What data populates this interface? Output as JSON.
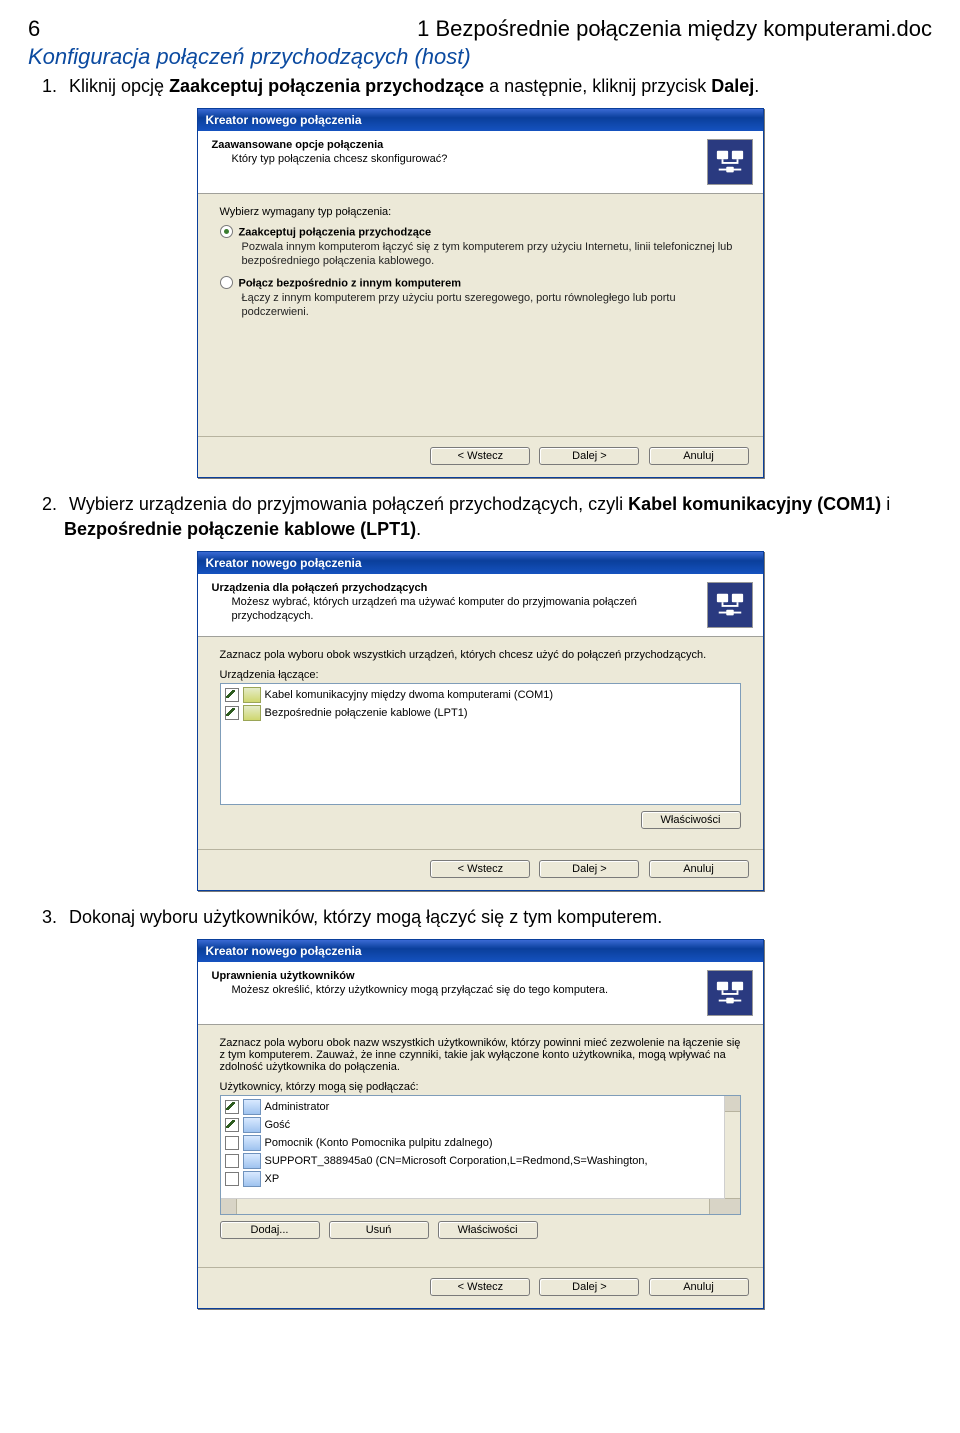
{
  "header": {
    "page_no": "6",
    "doc_title": "1 Bezpośrednie połączenia między komputerami.doc"
  },
  "subheader": "Konfiguracja połączeń przychodzących (host)",
  "steps": {
    "s1_pre": "Kliknij opcję ",
    "s1_bold": "Zaakceptuj połączenia przychodzące",
    "s1_mid": " a następnie, kliknij przycisk ",
    "s1_bold2": "Dalej",
    "s2_pre": "Wybierz urządzenia do przyjmowania połączeń przychodzących, czyli ",
    "s2_bold1": "Kabel komunikacyjny (COM1)",
    "s2_mid": " i ",
    "s2_bold2": "Bezpośrednie połączenie kablowe (LPT1)",
    "s3": "Dokonaj wyboru użytkowników, którzy mogą łączyć się z tym komputerem."
  },
  "wizard_common": {
    "title": "Kreator nowego połączenia",
    "btn_back": "< Wstecz",
    "btn_next": "Dalej >",
    "btn_cancel": "Anuluj",
    "btn_props": "Właściwości",
    "btn_add": "Dodaj...",
    "btn_remove": "Usuń"
  },
  "dlg1": {
    "h1": "Zaawansowane opcje połączenia",
    "h2": "Który typ połączenia chcesz skonfigurować?",
    "label": "Wybierz wymagany typ połączenia:",
    "opt1": "Zaakceptuj połączenia przychodzące",
    "opt1_desc": "Pozwala innym komputerom łączyć się z tym komputerem przy użyciu Internetu, linii telefonicznej lub bezpośredniego połączenia kablowego.",
    "opt2": "Połącz bezpośrednio z innym komputerem",
    "opt2_desc": "Łączy z innym komputerem przy użyciu portu szeregowego, portu równoległego lub portu podczerwieni."
  },
  "dlg2": {
    "h1": "Urządzenia dla połączeń przychodzących",
    "h2": "Możesz wybrać, których urządzeń ma używać komputer do przyjmowania połączeń przychodzących.",
    "label": "Zaznacz pola wyboru obok wszystkich urządzeń, których chcesz użyć do połączeń przychodzących.",
    "list_label": "Urządzenia łączące:",
    "item1": "Kabel komunikacyjny między dwoma komputerami (COM1)",
    "item2": "Bezpośrednie połączenie kablowe (LPT1)"
  },
  "dlg3": {
    "h1": "Uprawnienia użytkowników",
    "h2": "Możesz określić, którzy użytkownicy mogą przyłączać się do tego komputera.",
    "label": "Zaznacz pola wyboru obok nazw wszystkich użytkowników, którzy powinni mieć zezwolenie na łączenie się z tym komputerem. Zauważ, że inne czynniki, takie jak wyłączone konto użytkownika, mogą wpływać na zdolność użytkownika do połączenia.",
    "list_label": "Użytkownicy, którzy mogą się podłączać:",
    "u1": "Administrator",
    "u2": "Gość",
    "u3": "Pomocnik (Konto Pomocnika pulpitu zdalnego)",
    "u4": "SUPPORT_388945a0 (CN=Microsoft Corporation,L=Redmond,S=Washington,",
    "u5": "XP"
  }
}
